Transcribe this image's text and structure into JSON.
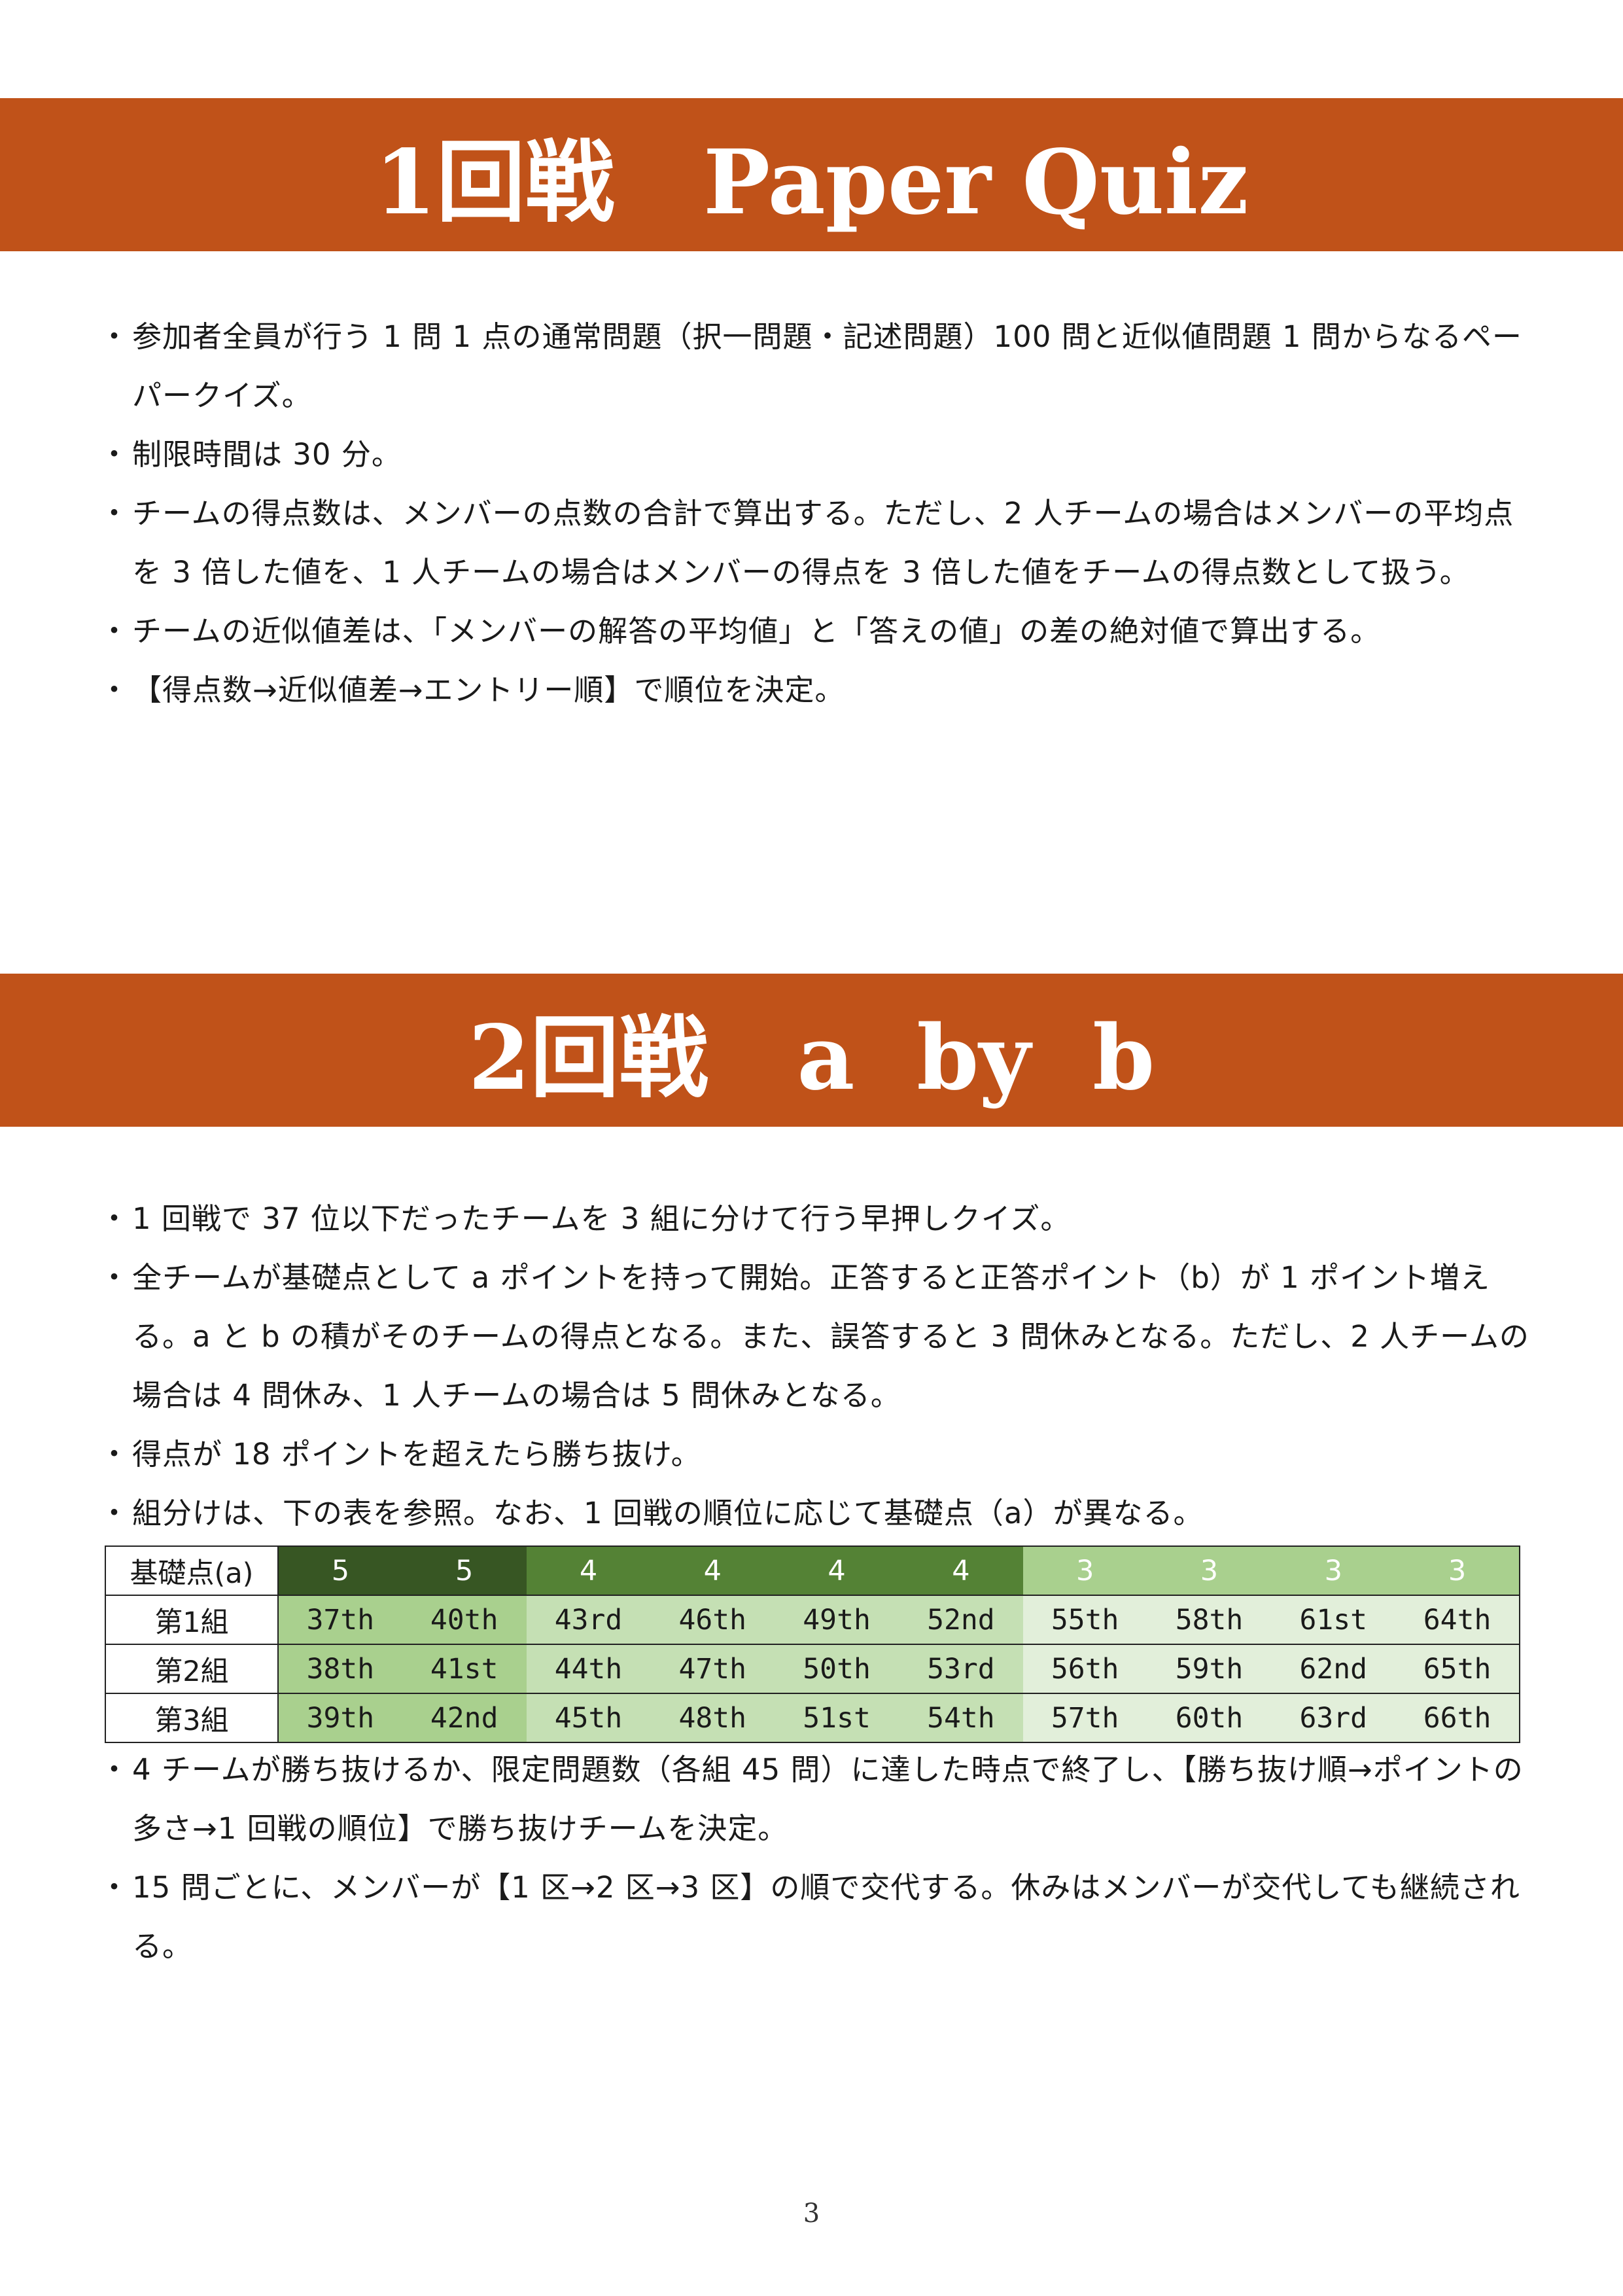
{
  "round1": {
    "title": "1回戦　Paper Quiz",
    "bullets": [
      "参加者全員が行う 1 問 1 点の通常問題（択一問題・記述問題）100 問と近似値問題 1 問からなるペーパークイズ。",
      "制限時間は 30 分。",
      "チームの得点数は、メンバーの点数の合計で算出する。ただし、2 人チームの場合はメンバーの平均点を 3 倍した値を、1 人チームの場合はメンバーの得点を 3 倍した値をチームの得点数として扱う。",
      "チームの近似値差は、「メンバーの解答の平均値」と「答えの値」の差の絶対値で算出する。",
      "【得点数→近似値差→エントリー順】で順位を決定。"
    ]
  },
  "round2": {
    "title": "2回戦　a  by  b",
    "bullets": [
      "1 回戦で 37 位以下だったチームを 3 組に分けて行う早押しクイズ。",
      "全チームが基礎点として a ポイントを持って開始。正答すると正答ポイント（b）が 1 ポイント増える。a と b の積がそのチームの得点となる。また、誤答すると 3 問休みとなる。ただし、2 人チームの場合は 4 問休み、1 人チームの場合は 5 問休みとなる。",
      "得点が 18 ポイントを超えたら勝ち抜け。",
      "組分けは、下の表を参照。なお、1 回戦の順位に応じて基礎点（a）が異なる。"
    ],
    "bullets_after_table": [
      "4 チームが勝ち抜けるか、限定問題数（各組 45 問）に達した時点で終了し、【勝ち抜け順→ポイントの多さ→1 回戦の順位】で勝ち抜けチームを決定。",
      "15 問ごとに、メンバーが【1 区→2 区→3 区】の順で交代する。休みはメンバーが交代しても継続される。"
    ],
    "table": {
      "header_label": "基礎点(a)",
      "header_values": [
        "5",
        "5",
        "4",
        "4",
        "4",
        "4",
        "3",
        "3",
        "3",
        "3"
      ],
      "rows": [
        {
          "label": "第1組",
          "cells": [
            "37th",
            "40th",
            "43rd",
            "46th",
            "49th",
            "52nd",
            "55th",
            "58th",
            "61st",
            "64th"
          ]
        },
        {
          "label": "第2組",
          "cells": [
            "38th",
            "41st",
            "44th",
            "47th",
            "50th",
            "53rd",
            "56th",
            "59th",
            "62nd",
            "65th"
          ]
        },
        {
          "label": "第3組",
          "cells": [
            "39th",
            "42nd",
            "45th",
            "48th",
            "51st",
            "54th",
            "57th",
            "60th",
            "63rd",
            "66th"
          ]
        }
      ],
      "colors": {
        "header_a5": "#375623",
        "header_a4": "#548235",
        "header_a3": "#a9d08e",
        "cell_a5": "#a9d08e",
        "cell_a4": "#c5e0b4",
        "cell_a3": "#e2efda"
      }
    }
  },
  "banner_color": "#c05219",
  "page_number": "3"
}
